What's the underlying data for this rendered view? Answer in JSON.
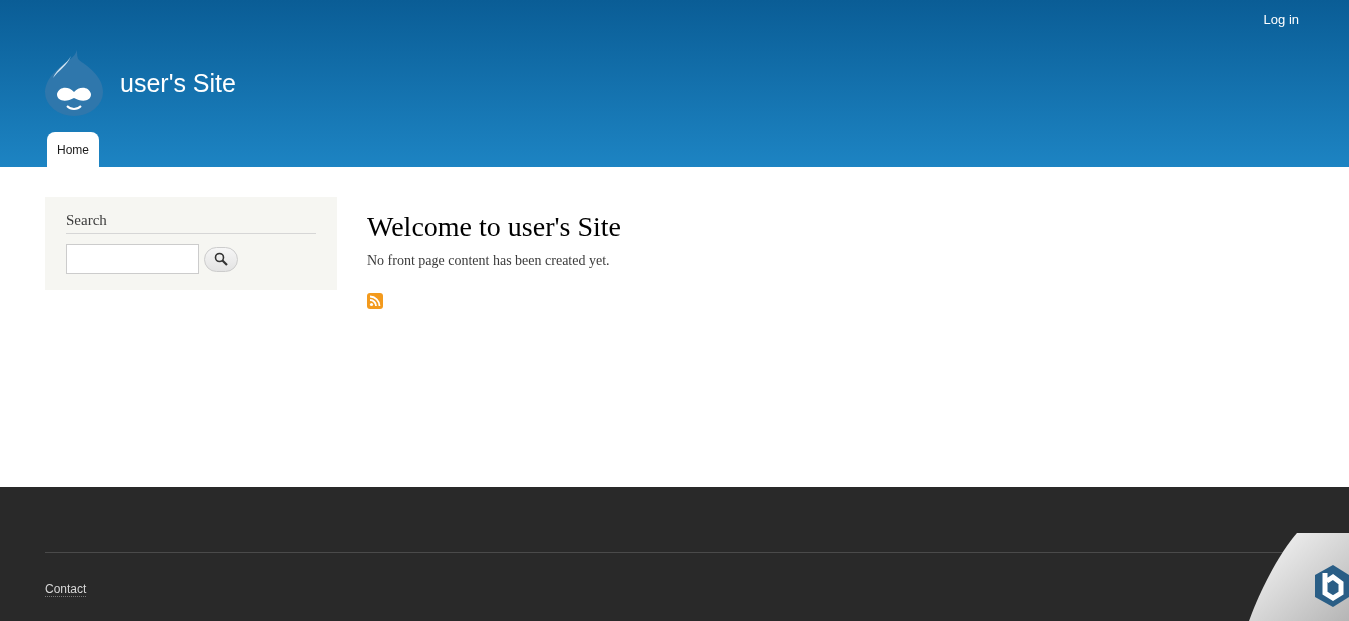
{
  "header": {
    "site_name": "user's Site",
    "user_menu": [
      "Log in"
    ],
    "nav": [
      {
        "label": "Home",
        "selected": true
      }
    ]
  },
  "sidebar": {
    "search_block": {
      "title": "Search"
    }
  },
  "content": {
    "title": "Welcome to user's Site",
    "message": "No front page content has been created yet."
  },
  "footer": {
    "links": [
      "Contact"
    ]
  }
}
